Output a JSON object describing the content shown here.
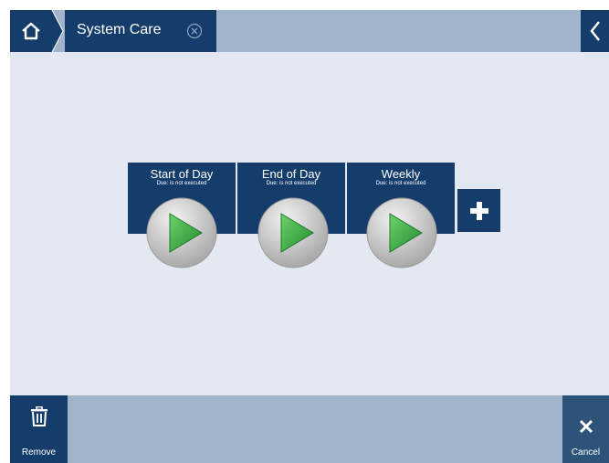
{
  "header": {
    "tab_title": "System Care",
    "icons": {
      "home": "home-icon",
      "close": "close-circle-icon",
      "back": "chevron-left-icon"
    }
  },
  "routines": [
    {
      "title": "Start of Day",
      "due": "Due: is not executed"
    },
    {
      "title": "End of Day",
      "due": "Due: is not executed"
    },
    {
      "title": "Weekly",
      "due": "Due: is not executed"
    }
  ],
  "add_button": {
    "icon": "plus-icon"
  },
  "footer": {
    "remove_label": "Remove",
    "cancel_label": "Cancel",
    "icons": {
      "remove": "trash-icon",
      "cancel": "x-icon"
    }
  },
  "colors": {
    "accent": "#153d6b",
    "bar": "#a2b4cb",
    "background": "#e4e8f2",
    "play_green": "#3aa645"
  }
}
